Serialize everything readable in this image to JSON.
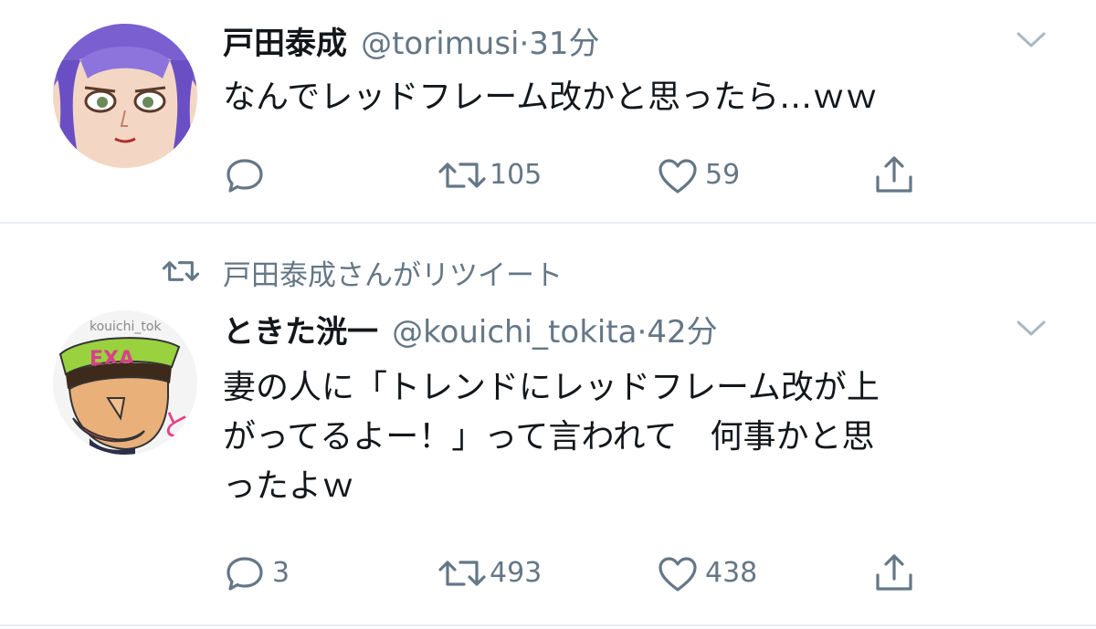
{
  "tweets": [
    {
      "display_name": "戸田泰成",
      "handle": "@torimusi",
      "dot": "·",
      "time": "31分",
      "text": "なんでレッドフレーム改かと思ったら…ｗｗ",
      "reply_count": "",
      "retweet_count": "105",
      "like_count": "59",
      "avatar_icon": "anime-girl-avatar"
    },
    {
      "retweeted_by": "戸田泰成さんがリツイート",
      "display_name": "ときた洸一",
      "handle": "@kouichi_tokita",
      "dot": "·",
      "time": "42分",
      "text": "妻の人に「トレンドにレッドフレーム改が上\nがってるよー！」って言われて　何事かと思\nったよｗ",
      "reply_count": "3",
      "retweet_count": "493",
      "like_count": "438",
      "avatar_icon": "cartoon-man-avatar",
      "avatar_text": "kouichi_tok",
      "avatar_hat_text": "EXA",
      "avatar_side_text": "と"
    }
  ],
  "colors": {
    "text": "#14171a",
    "secondary": "#657786",
    "separator": "#e6ecf0",
    "chevron": "#aab8c2"
  }
}
